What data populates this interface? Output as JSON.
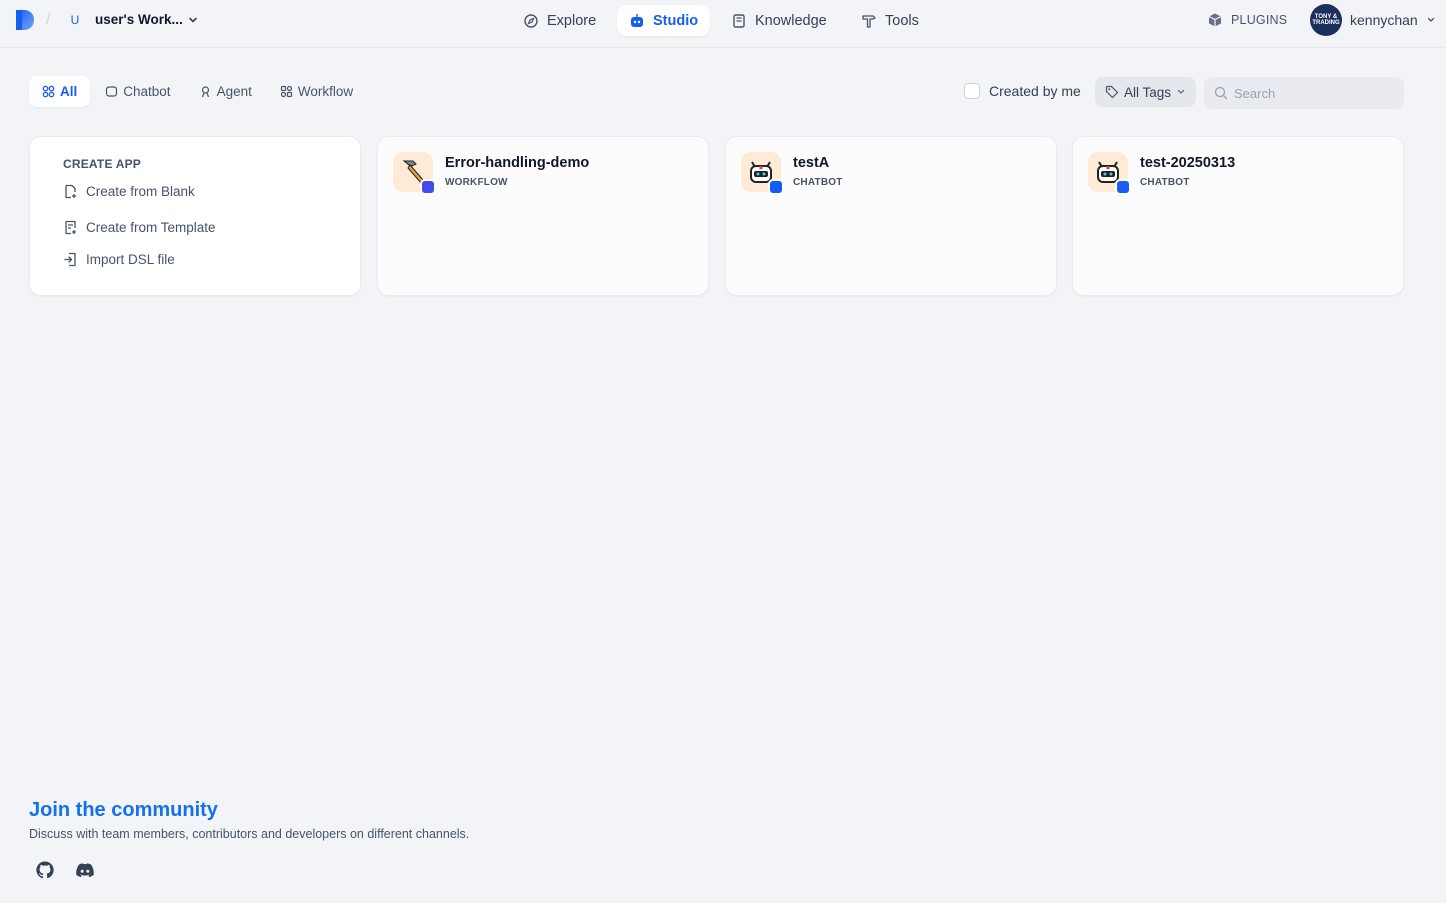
{
  "header": {
    "workspace_initial": "U",
    "workspace_name": "user's Work...",
    "nav": [
      {
        "label": "Explore",
        "icon": "compass-icon"
      },
      {
        "label": "Studio",
        "icon": "robot-icon"
      },
      {
        "label": "Knowledge",
        "icon": "book-icon"
      },
      {
        "label": "Tools",
        "icon": "hammer-icon"
      }
    ],
    "plugins_label": "PLUGINS",
    "user_name": "kennychan",
    "user_avatar_text": "TONY & TRADING"
  },
  "filters": {
    "tabs": [
      {
        "label": "All",
        "active": true
      },
      {
        "label": "Chatbot",
        "active": false
      },
      {
        "label": "Agent",
        "active": false
      },
      {
        "label": "Workflow",
        "active": false
      }
    ],
    "created_by_me_label": "Created by me",
    "tags_label": "All Tags",
    "search_placeholder": "Search"
  },
  "create_app": {
    "title": "CREATE APP",
    "items": [
      {
        "label": "Create from Blank",
        "icon": "file-plus-icon"
      },
      {
        "label": "Create from Template",
        "icon": "template-icon"
      },
      {
        "label": "Import DSL file",
        "icon": "import-icon"
      }
    ]
  },
  "apps": [
    {
      "name": "Error-handling-demo",
      "type": "WORKFLOW",
      "icon": "hammer-emoji",
      "badge_color": "#444ce7"
    },
    {
      "name": "testA",
      "type": "CHATBOT",
      "icon": "robot-emoji",
      "badge_color": "#155eef"
    },
    {
      "name": "test-20250313",
      "type": "CHATBOT",
      "icon": "robot-emoji",
      "badge_color": "#155eef"
    }
  ],
  "community": {
    "title": "Join the community",
    "description": "Discuss with team members, contributors and developers on different channels."
  },
  "colors": {
    "accent": "#155eef",
    "community_blue": "#1570ef",
    "background": "#f2f4f7"
  }
}
